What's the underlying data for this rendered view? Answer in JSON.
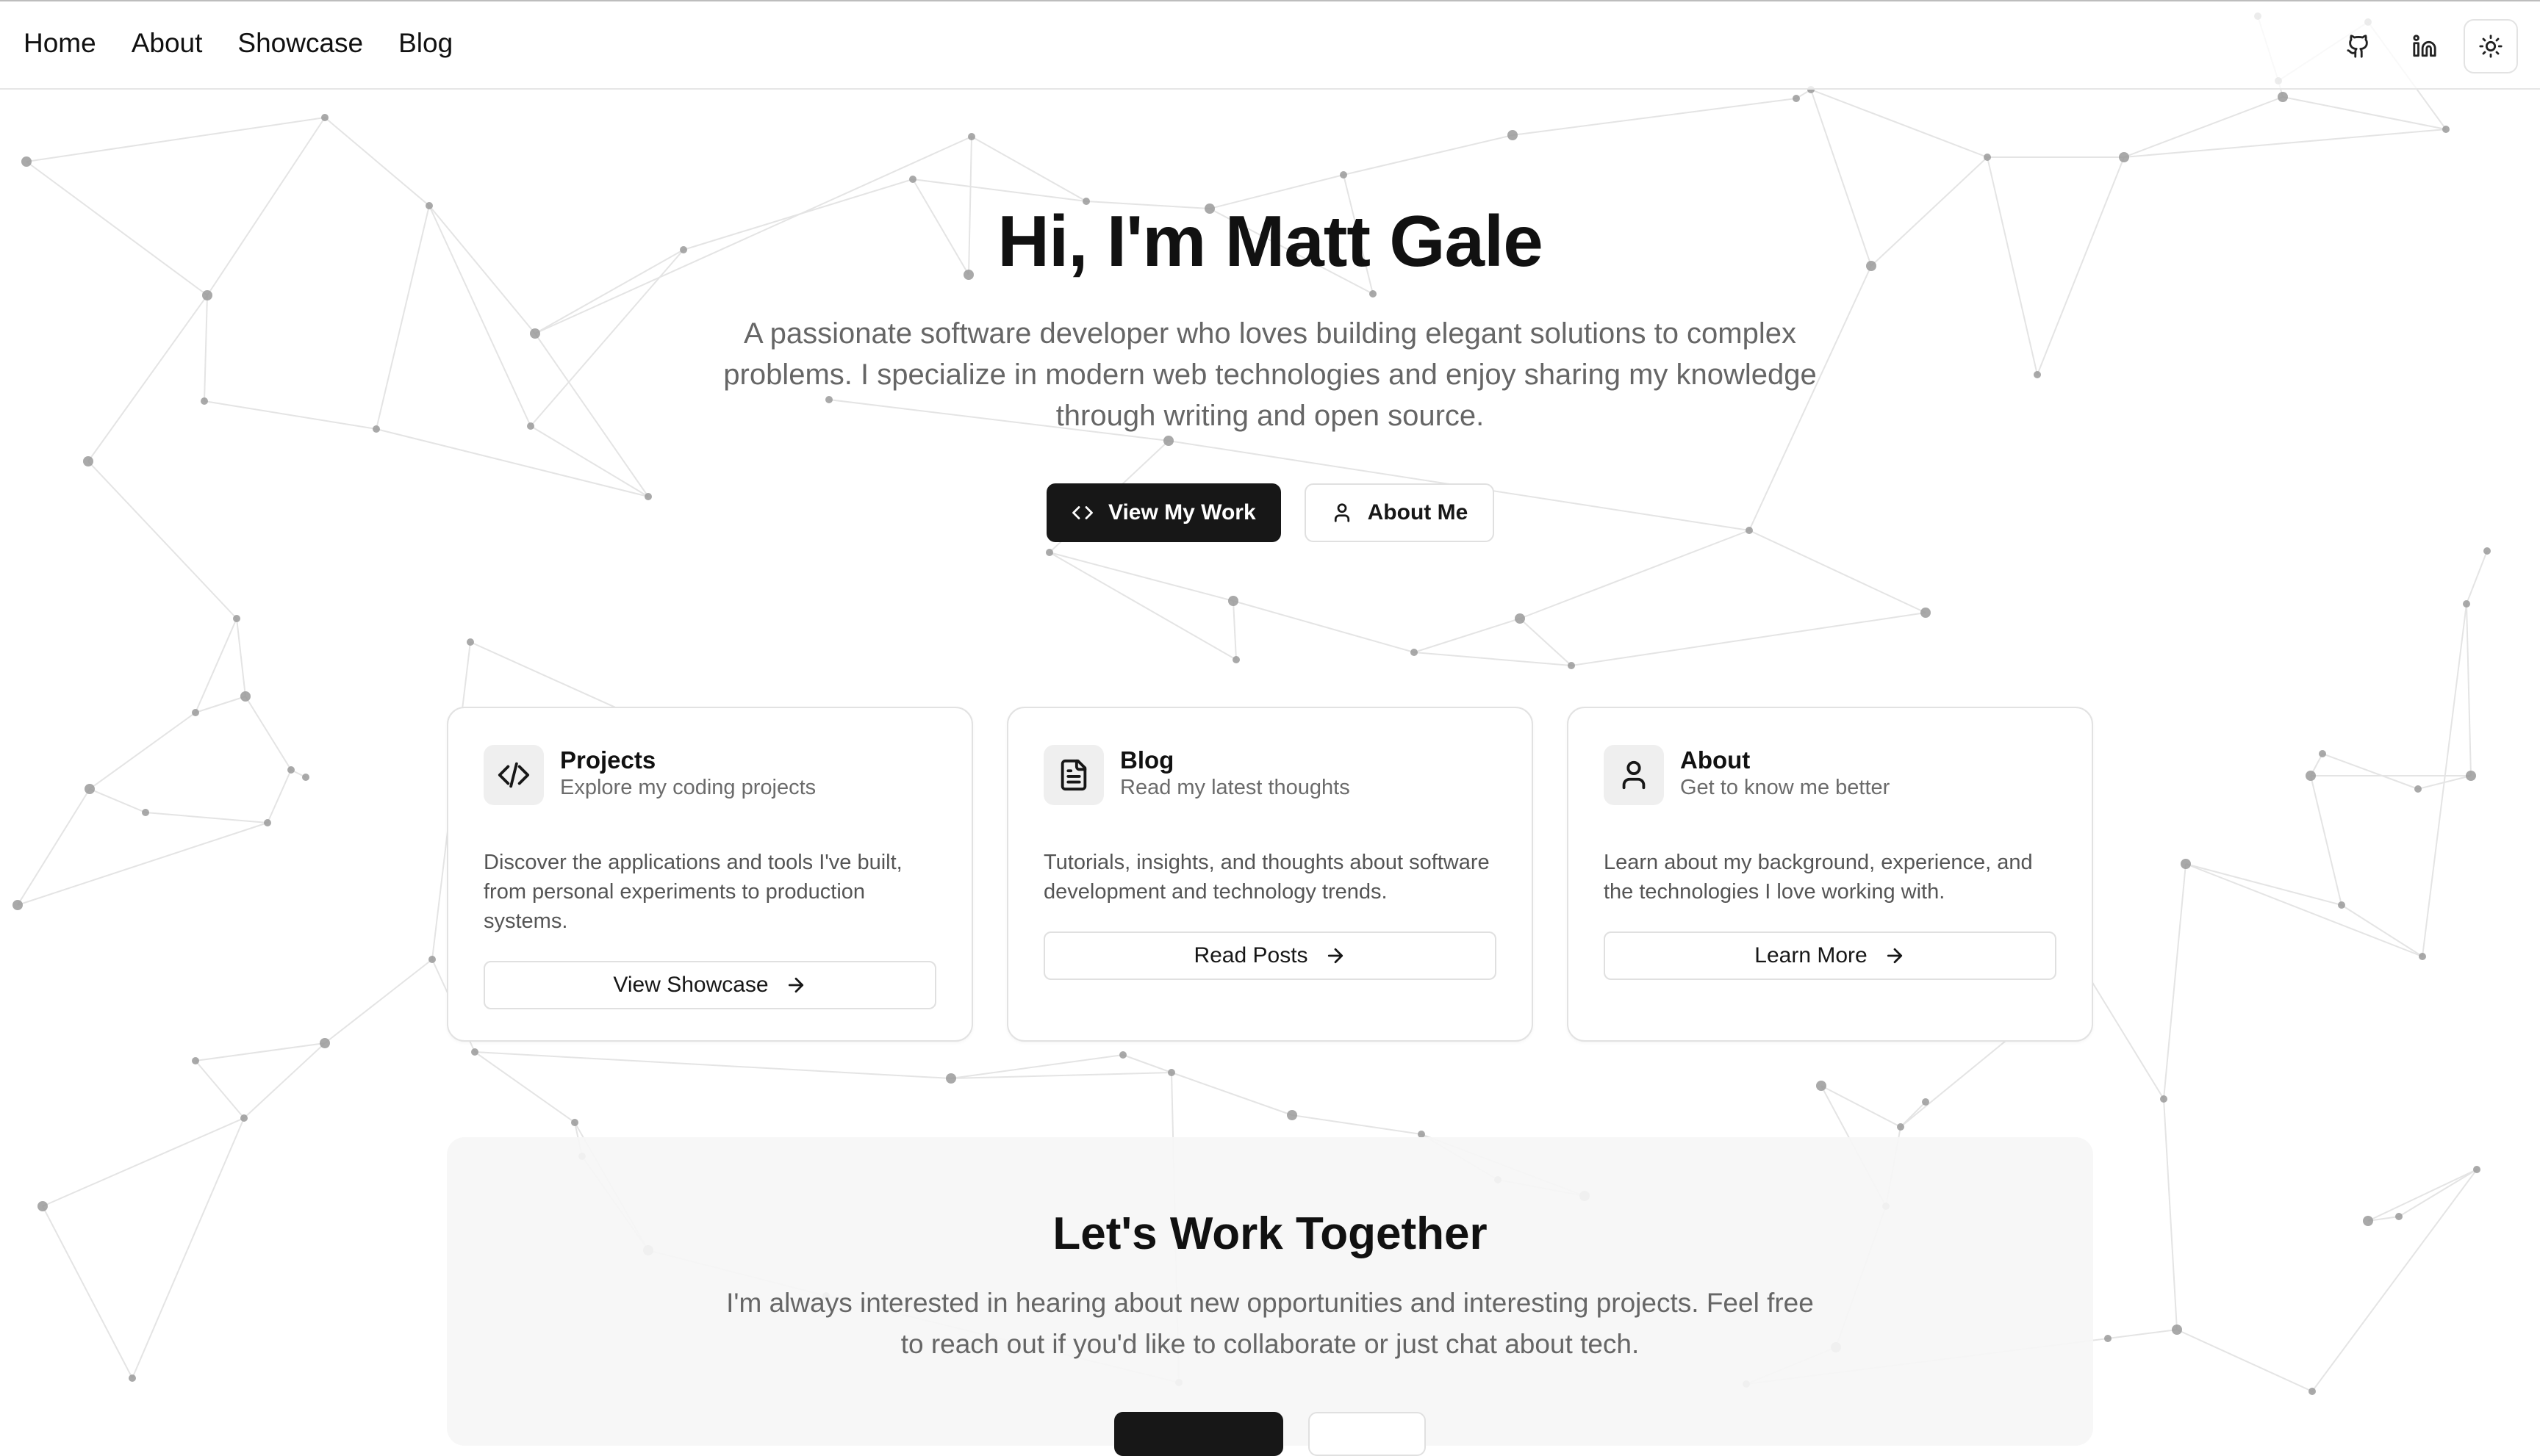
{
  "nav": {
    "links": [
      "Home",
      "About",
      "Showcase",
      "Blog"
    ],
    "actions": [
      {
        "icon": "github-icon",
        "label": "GitHub"
      },
      {
        "icon": "linkedin-icon",
        "label": "LinkedIn"
      },
      {
        "icon": "sun-icon",
        "label": "Toggle theme"
      }
    ]
  },
  "hero": {
    "title": "Hi, I'm Matt Gale",
    "subtitle": "A passionate software developer who loves building elegant solutions to complex problems. I specialize in modern web technologies and enjoy sharing my knowledge through writing and open source.",
    "primary_button": {
      "label": "View My Work",
      "icon": "code-icon"
    },
    "secondary_button": {
      "label": "About Me",
      "icon": "user-icon"
    }
  },
  "cards": [
    {
      "title": "Projects",
      "subtitle": "Explore my coding projects",
      "description": "Discover the applications and tools I've built, from personal experiments to production systems.",
      "button": "View Showcase",
      "icon": "code-icon"
    },
    {
      "title": "Blog",
      "subtitle": "Read my latest thoughts",
      "description": "Tutorials, insights, and thoughts about software development and technology trends.",
      "button": "Read Posts",
      "icon": "document-icon"
    },
    {
      "title": "About",
      "subtitle": "Get to know me better",
      "description": "Learn about my background, experience, and the technologies I love working with.",
      "button": "Learn More",
      "icon": "user-icon"
    }
  ],
  "cta": {
    "title": "Let's Work Together",
    "subtitle": "I'm always interested in hearing about new opportunities and interesting projects. Feel free to reach out if you'd like to collaborate or just chat about tech."
  },
  "colors": {
    "background": "#ffffff",
    "text": "#171717",
    "muted": "#666666",
    "primary_button": "#171717",
    "border": "#e2e2e2",
    "network_lines": "#e4e4e4",
    "network_nodes": "#9a9a9a"
  }
}
